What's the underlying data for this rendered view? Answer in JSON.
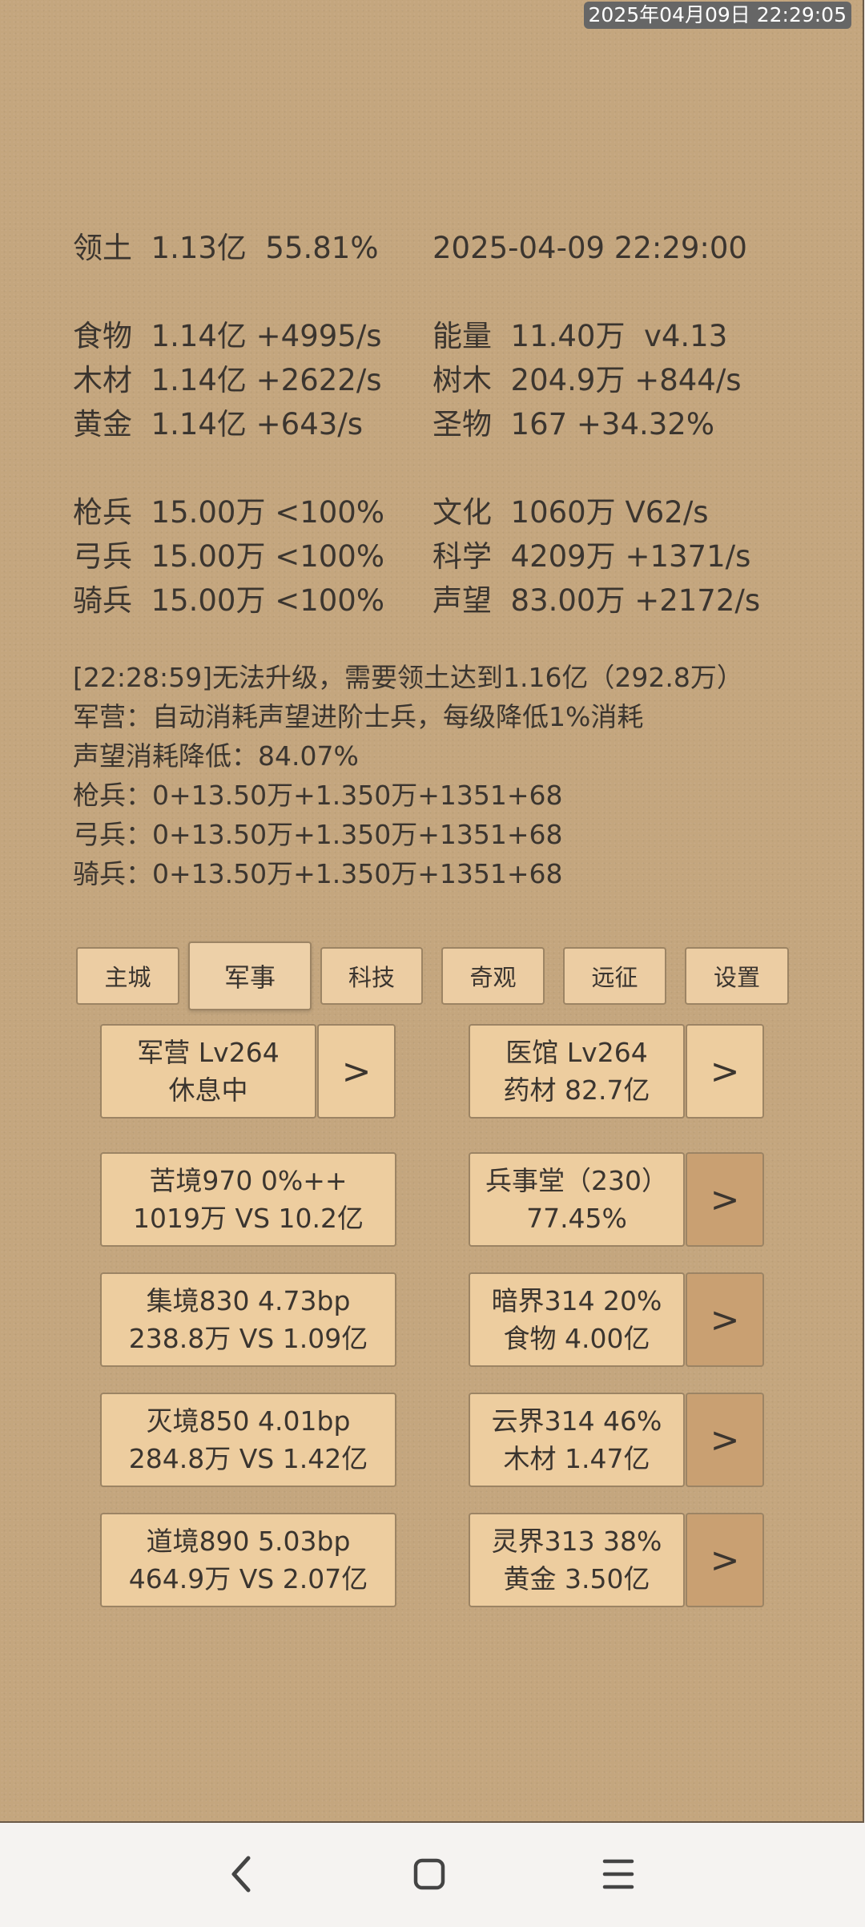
{
  "status_bar": {
    "time": "2025年04月09日 22:29:05"
  },
  "stats": {
    "territory": "领土  1.13亿  55.81%",
    "datetime": "2025-04-09 22:29:00",
    "food": "食物  1.14亿 +4995/s",
    "energy": "能量  11.40万  v4.13",
    "wood": "木材  1.14亿 +2622/s",
    "tree": "树木  204.9万 +844/s",
    "gold": "黄金  1.14亿 +643/s",
    "relic": "圣物  167 +34.32%",
    "spearman": "枪兵  15.00万 <100%",
    "culture": "文化  1060万 V62/s",
    "archer": "弓兵  15.00万 <100%",
    "science": "科学  4209万 +1371/s",
    "cavalry": "骑兵  15.00万 <100%",
    "prestige": "声望  83.00万 +2172/s"
  },
  "log": [
    "[22:28:59]无法升级，需要领土达到1.16亿（292.8万）",
    "军营：自动消耗声望进阶士兵，每级降低1%消耗",
    "声望消耗降低：84.07%",
    "枪兵：0+13.50万+1.350万+1351+68",
    "弓兵：0+13.50万+1.350万+1351+68",
    "骑兵：0+13.50万+1.350万+1351+68"
  ],
  "tabs": [
    "主城",
    "军事",
    "科技",
    "奇观",
    "远征",
    "设置"
  ],
  "active_tab": "军事",
  "cards": {
    "barracks": {
      "line1": "军营 Lv264",
      "line2": "休息中"
    },
    "clinic": {
      "line1": "医馆 Lv264",
      "line2": "药材 82.7亿"
    },
    "kujing": {
      "line1": "苦境970  0%++",
      "line2": "1019万 VS 10.2亿"
    },
    "bingshitang": {
      "line1": "兵事堂（230）",
      "line2": "77.45%"
    },
    "jijing": {
      "line1": "集境830  4.73bp",
      "line2": "238.8万 VS 1.09亿"
    },
    "anjie": {
      "line1": "暗界314  20%",
      "line2": "食物 4.00亿"
    },
    "miejing": {
      "line1": "灭境850  4.01bp",
      "line2": "284.8万 VS 1.42亿"
    },
    "yunjie": {
      "line1": "云界314  46%",
      "line2": "木材 1.47亿"
    },
    "daojing": {
      "line1": "道境890  5.03bp",
      "line2": "464.9万 VS 2.07亿"
    },
    "lingjie": {
      "line1": "灵界313  38%",
      "line2": "黄金 3.50亿"
    }
  },
  "arrow_label": ">",
  "icons": {
    "back": "chevron-left-icon",
    "home": "rounded-square-icon",
    "menu": "hamburger-menu-icon"
  }
}
